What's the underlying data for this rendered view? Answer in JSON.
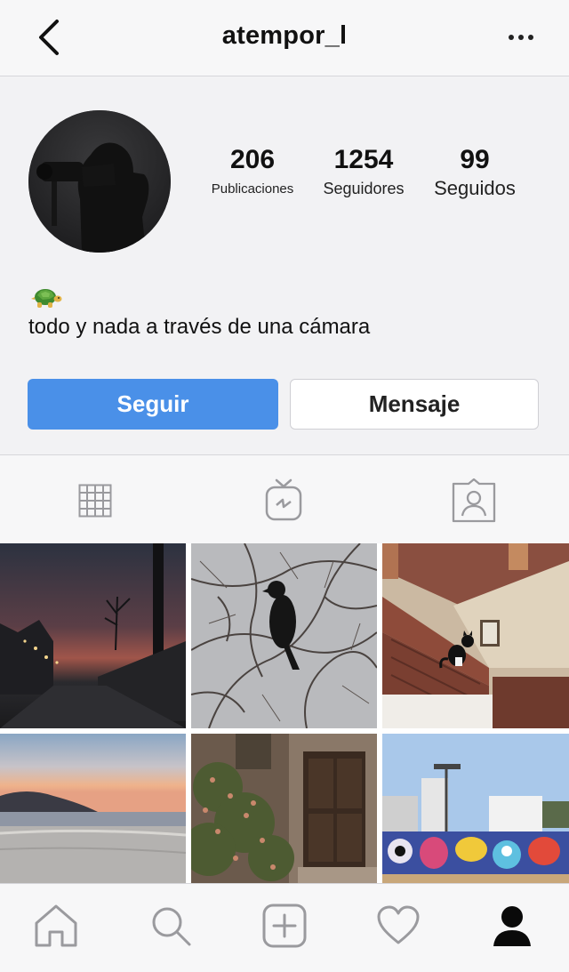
{
  "header": {
    "username": "atempor_l",
    "back_icon": "chevron-left-icon",
    "more_icon": "ellipsis-icon"
  },
  "profile": {
    "avatar": "profile-photo",
    "stats": {
      "posts": {
        "value": "206",
        "label": "Publicaciones"
      },
      "followers": {
        "value": "1254",
        "label": "Seguidores"
      },
      "following": {
        "value": "99",
        "label": "Seguidos"
      }
    },
    "bio": {
      "emoji": "🐢",
      "text": "todo y nada a través de una cámara"
    },
    "buttons": {
      "follow_label": "Seguir",
      "message_label": "Mensaje"
    }
  },
  "tabs": [
    {
      "icon": "grid-icon",
      "active": true
    },
    {
      "icon": "igtv-icon",
      "active": false
    },
    {
      "icon": "tagged-icon",
      "active": false
    }
  ],
  "posts": [
    {
      "description_icon": "photo-sunset-street"
    },
    {
      "description_icon": "photo-crow-branches"
    },
    {
      "description_icon": "photo-cat-rooftop"
    },
    {
      "description_icon": "photo-beach-sunset"
    },
    {
      "description_icon": "photo-old-door"
    },
    {
      "description_icon": "photo-graffiti-wall"
    }
  ],
  "bottom_nav": [
    {
      "icon": "home-icon"
    },
    {
      "icon": "search-icon"
    },
    {
      "icon": "add-post-icon"
    },
    {
      "icon": "heart-icon"
    },
    {
      "icon": "profile-icon",
      "active": true
    }
  ],
  "colors": {
    "accent": "#4a90e8",
    "background": "#f2f2f4",
    "bar": "#f7f7f8",
    "divider": "#d6d6da"
  }
}
